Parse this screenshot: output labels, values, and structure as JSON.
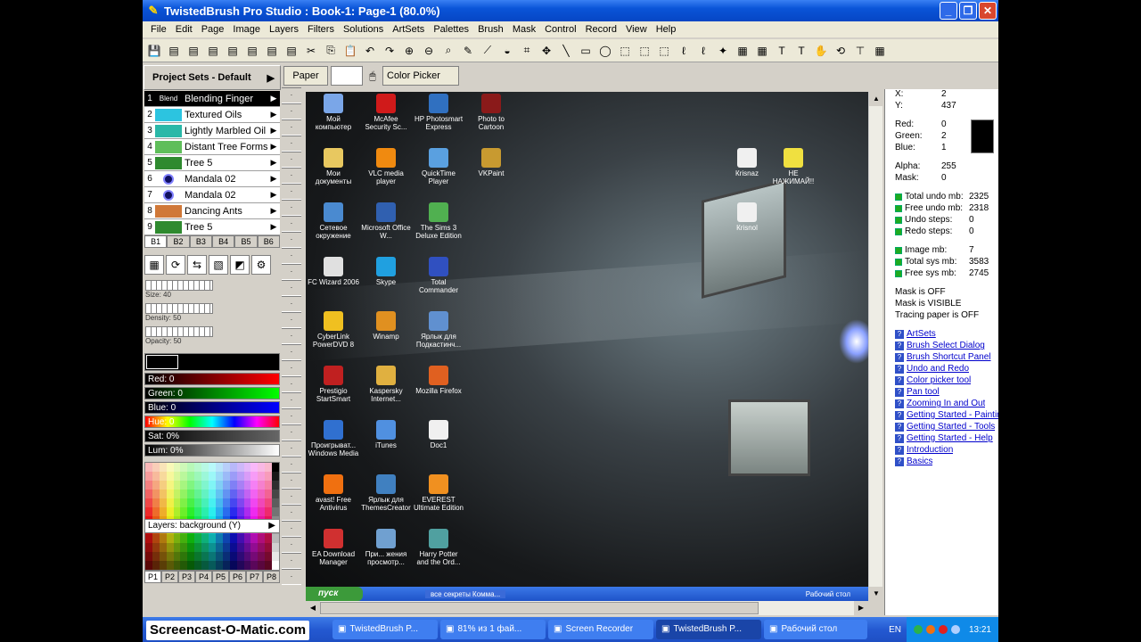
{
  "window": {
    "title": "TwistedBrush Pro Studio : Book-1: Page-1 (80.0%)"
  },
  "menu": [
    "File",
    "Edit",
    "Page",
    "Image",
    "Layers",
    "Filters",
    "Solutions",
    "ArtSets",
    "Palettes",
    "Brush",
    "Mask",
    "Control",
    "Record",
    "View",
    "Help"
  ],
  "toolbar_icons": [
    "save-icon",
    "page-icon",
    "page-icon",
    "page-icon",
    "page-icon",
    "page-icon",
    "page-icon",
    "page-icon",
    "cut-icon",
    "copy-icon",
    "paste-icon",
    "undo-icon",
    "redo-icon",
    "zoom-in-icon",
    "zoom-out-icon",
    "zoom-icon",
    "brush-icon",
    "dropper-icon",
    "bucket-icon",
    "crop-icon",
    "move-icon",
    "line-icon",
    "rect-icon",
    "ellipse-icon",
    "select-icon",
    "select-icon",
    "select-icon",
    "lasso-icon",
    "lasso-icon",
    "wand-icon",
    "grid-icon",
    "grid-icon",
    "text-icon",
    "text-icon",
    "hand-icon",
    "rotate-icon",
    "stamp-icon",
    "grid-icon"
  ],
  "project_sets": {
    "title": "Project Sets - Default",
    "arrow": "▶",
    "brushes": [
      {
        "num": "1",
        "thumb": "Blend",
        "label": "Blending Finger",
        "color": "#000000",
        "selected": true
      },
      {
        "num": "2",
        "thumb": "",
        "label": "Textured Oils",
        "color": "#2cc4e0"
      },
      {
        "num": "3",
        "thumb": "",
        "label": "Lightly Marbled Oil",
        "color": "#2ab8a8"
      },
      {
        "num": "4",
        "thumb": "",
        "label": "Distant Tree Forms 3",
        "color": "#5fbe5a"
      },
      {
        "num": "5",
        "thumb": "",
        "label": "Tree 5",
        "color": "#2f8a2f"
      },
      {
        "num": "6",
        "thumb": "",
        "label": "Mandala 02",
        "color": "#101060"
      },
      {
        "num": "7",
        "thumb": "",
        "label": "Mandala 02",
        "color": "#101060"
      },
      {
        "num": "8",
        "thumb": "",
        "label": "Dancing Ants",
        "color": "#d07838"
      },
      {
        "num": "9",
        "thumb": "",
        "label": "Tree 5",
        "color": "#2f8a2f"
      }
    ],
    "brush_tabs": [
      "B1",
      "B2",
      "B3",
      "B4",
      "B5",
      "B6"
    ],
    "palette_tabs": [
      "P1",
      "P2",
      "P3",
      "P4",
      "P5",
      "P6",
      "P7",
      "P8"
    ]
  },
  "sliders": [
    {
      "label": "Size: 40",
      "level": 40
    },
    {
      "label": "Density: 50",
      "level": 50
    },
    {
      "label": "Opacity: 50",
      "level": 50
    }
  ],
  "color_bars": [
    {
      "label": "Red: 0",
      "gradient": "linear-gradient(90deg,#000,#ff0000)"
    },
    {
      "label": "Green: 0",
      "gradient": "linear-gradient(90deg,#000,#00ff00)"
    },
    {
      "label": "Blue: 0",
      "gradient": "linear-gradient(90deg,#000,#0000ff)"
    },
    {
      "label": "Hue: 0",
      "gradient": "linear-gradient(90deg,#f00,#ff0,#0f0,#0ff,#00f,#f0f,#f00)"
    },
    {
      "label": "Sat: 0%",
      "gradient": "linear-gradient(90deg,#000,#666)"
    },
    {
      "label": "Lum: 0%",
      "gradient": "linear-gradient(90deg,#000,#fff)"
    }
  ],
  "layers_label": "Layers: background (Y)",
  "options": {
    "paper_label": "Paper",
    "tool_label": "Color Picker"
  },
  "desktop_icons": [
    {
      "label": "Мой компьютер",
      "color": "#7aa6e8",
      "col": 0,
      "row": 0
    },
    {
      "label": "McAfee Security Sc...",
      "color": "#d01a1a",
      "col": 1,
      "row": 0
    },
    {
      "label": "HP Photosmart Express",
      "color": "#3070c0",
      "col": 2,
      "row": 0
    },
    {
      "label": "Photo to Cartoon",
      "color": "#8a1a1a",
      "col": 3,
      "row": 0
    },
    {
      "label": "Мои документы",
      "color": "#e8c860",
      "col": 0,
      "row": 1
    },
    {
      "label": "VLC media player",
      "color": "#f08a10",
      "col": 1,
      "row": 1
    },
    {
      "label": "QuickTime Player",
      "color": "#5aa0e0",
      "col": 2,
      "row": 1
    },
    {
      "label": "VKPaint",
      "color": "#c89a30",
      "col": 3,
      "row": 1
    },
    {
      "label": "Сетевое окружение",
      "color": "#4a8ad0",
      "col": 0,
      "row": 2
    },
    {
      "label": "Microsoft Office W...",
      "color": "#3060b0",
      "col": 1,
      "row": 2
    },
    {
      "label": "The Sims 3 Deluxe Edition",
      "color": "#50b050",
      "col": 2,
      "row": 2
    },
    {
      "label": "FC Wizard 2006",
      "color": "#e0e0e0",
      "col": 0,
      "row": 3
    },
    {
      "label": "Skype",
      "color": "#20a0e0",
      "col": 1,
      "row": 3
    },
    {
      "label": "Total Commander",
      "color": "#3050c0",
      "col": 2,
      "row": 3
    },
    {
      "label": "CyberLink PowerDVD 8",
      "color": "#f0c020",
      "col": 0,
      "row": 4
    },
    {
      "label": "Winamp",
      "color": "#e09020",
      "col": 1,
      "row": 4
    },
    {
      "label": "Ярлык для Подкаcтинч...",
      "color": "#6090d0",
      "col": 2,
      "row": 4
    },
    {
      "label": "Prestigio StartSmart",
      "color": "#c02020",
      "col": 0,
      "row": 5
    },
    {
      "label": "Kaspersky Internet...",
      "color": "#e0b040",
      "col": 1,
      "row": 5
    },
    {
      "label": "Mozilla Firefox",
      "color": "#e06020",
      "col": 2,
      "row": 5
    },
    {
      "label": "Проигрыват... Windows Media",
      "color": "#3070d0",
      "col": 0,
      "row": 6
    },
    {
      "label": "iTunes",
      "color": "#5090e0",
      "col": 1,
      "row": 6
    },
    {
      "label": "Doc1",
      "color": "#f0f0f0",
      "col": 2,
      "row": 6
    },
    {
      "label": "avast! Free Antivirus",
      "color": "#f07010",
      "col": 0,
      "row": 7
    },
    {
      "label": "Ярлык для ThemesCreator",
      "color": "#4080c0",
      "col": 1,
      "row": 7
    },
    {
      "label": "EVEREST Ultimate Edition",
      "color": "#f09020",
      "col": 2,
      "row": 7
    },
    {
      "label": "EA Download Manager",
      "color": "#d03030",
      "col": 0,
      "row": 8
    },
    {
      "label": "При... жения просмотр...",
      "color": "#70a0d0",
      "col": 1,
      "row": 8
    },
    {
      "label": "Harry Potter and the Ord...",
      "color": "#50a0a0",
      "col": 2,
      "row": 8
    },
    {
      "label": "Кrisnaz",
      "color": "#f0f0f0",
      "col": 8,
      "row": 1
    },
    {
      "label": "НЕ НАЖИМАЙ!!",
      "color": "#f0e040",
      "col": 9,
      "row": 1
    },
    {
      "label": "Кrisnol",
      "color": "#f0f0f0",
      "col": 8,
      "row": 2
    }
  ],
  "inner_taskbar": {
    "start": "пуск",
    "task": "все секреты Коммa...",
    "right": "Рабочий стол"
  },
  "info": {
    "coords": [
      {
        "k": "X:",
        "v": "2"
      },
      {
        "k": "Y:",
        "v": "437"
      }
    ],
    "color": [
      {
        "k": "Red:",
        "v": "0"
      },
      {
        "k": "Green:",
        "v": "2"
      },
      {
        "k": "Blue:",
        "v": "1"
      }
    ],
    "alpha": [
      {
        "k": "Alpha:",
        "v": "255"
      },
      {
        "k": "Mask:",
        "v": "0"
      }
    ],
    "undo": [
      {
        "k": "Total undo mb:",
        "v": "2325"
      },
      {
        "k": "Free undo mb:",
        "v": "2318"
      },
      {
        "k": "Undo steps:",
        "v": "0"
      },
      {
        "k": "Redo steps:",
        "v": "0"
      }
    ],
    "mem": [
      {
        "k": "Image mb:",
        "v": "7"
      },
      {
        "k": "Total sys mb:",
        "v": "3583"
      },
      {
        "k": "Free sys mb:",
        "v": "2745"
      }
    ],
    "status": [
      "Mask is OFF",
      "Mask is VISIBLE",
      "Tracing paper is OFF"
    ],
    "help_links": [
      "ArtSets",
      "Brush Select Dialog",
      "Brush Shortcut Panel",
      "Undo and Redo",
      "Color picker tool",
      "Pan tool",
      "Zooming In and Out",
      "Getting Started - Painting",
      "Getting Started - Tools",
      "Getting Started - Help",
      "Introduction",
      "Basics"
    ]
  },
  "taskbar": {
    "watermark": "Screencast-O-Matic.com",
    "buttons": [
      {
        "label": "TwistedBrush P...",
        "active": false
      },
      {
        "label": "81% из 1 фай...",
        "active": false
      },
      {
        "label": "Screen Recorder",
        "active": false
      },
      {
        "label": "TwistedBrush P...",
        "active": true
      },
      {
        "label": "Рабочий стол",
        "active": false
      }
    ],
    "lang": "EN",
    "clock": "13:21"
  },
  "colors": {
    "accent": "#0a54d8",
    "selection": "#000000",
    "link": "#0000cc"
  }
}
